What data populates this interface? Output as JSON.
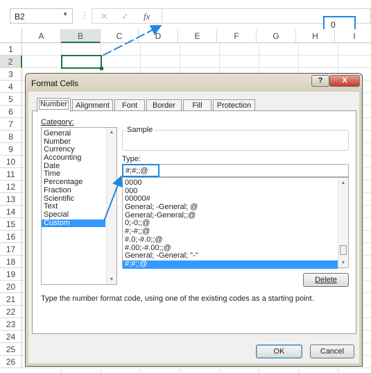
{
  "formula_bar": {
    "name_box": "B2",
    "cancel_icon": "✕",
    "enter_icon": "✓",
    "fx_label": "fx",
    "value": "0"
  },
  "columns": [
    "A",
    "B",
    "C",
    "D",
    "E",
    "F",
    "G",
    "H",
    "I"
  ],
  "rows": [
    "1",
    "2",
    "3",
    "4",
    "5",
    "6",
    "7",
    "8",
    "9",
    "10",
    "11",
    "12",
    "13",
    "14",
    "15",
    "16",
    "17",
    "18",
    "19",
    "20",
    "21",
    "22",
    "23",
    "24",
    "25",
    "26"
  ],
  "selected_cell": "B2",
  "dialog": {
    "title": "Format Cells",
    "help_label": "?",
    "close_label": "X",
    "tabs": [
      "Number",
      "Alignment",
      "Font",
      "Border",
      "Fill",
      "Protection"
    ],
    "active_tab": "Number",
    "category_label": "Category:",
    "categories": [
      "General",
      "Number",
      "Currency",
      "Accounting",
      "Date",
      "Time",
      "Percentage",
      "Fraction",
      "Scientific",
      "Text",
      "Special",
      "Custom"
    ],
    "selected_category": "Custom",
    "sample_label": "Sample",
    "type_label": "Type:",
    "type_value": "#;#;;@",
    "type_list": [
      "0000",
      "000",
      "00000#",
      "General; -General; @",
      "General;-General;;@",
      "0;-0;;@",
      "#;-#;;@",
      "#.0;-#.0;;@",
      "#.00;-#.00;;@",
      "General; -General; \"-\"",
      "#;#;;@"
    ],
    "selected_type": "#;#;;@",
    "delete_label": "Delete",
    "description": "Type the number format code, using one of the existing codes as a starting point.",
    "ok_label": "OK",
    "cancel_label": "Cancel"
  },
  "colors": {
    "accent": "#1e88e5",
    "selection": "#3399ff",
    "cell_border": "#217346"
  }
}
